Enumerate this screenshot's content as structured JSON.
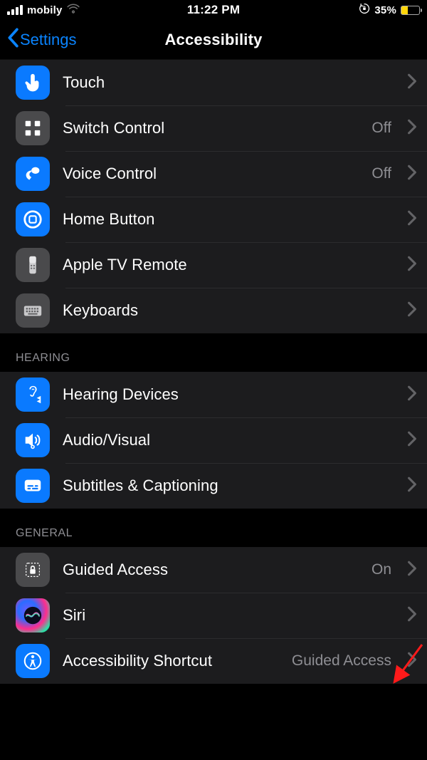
{
  "status": {
    "carrier": "mobily",
    "time": "11:22 PM",
    "battery_pct": "35%",
    "battery_level": 35,
    "battery_color": "#ffd60a"
  },
  "nav": {
    "back_label": "Settings",
    "title": "Accessibility"
  },
  "groups": [
    {
      "header": "",
      "rows": [
        {
          "icon": "touch-icon",
          "bg": "bg-blue",
          "label": "Touch",
          "value": ""
        },
        {
          "icon": "switch-control-icon",
          "bg": "bg-gray",
          "label": "Switch Control",
          "value": "Off"
        },
        {
          "icon": "voice-control-icon",
          "bg": "bg-blue",
          "label": "Voice Control",
          "value": "Off"
        },
        {
          "icon": "home-button-icon",
          "bg": "bg-blue",
          "label": "Home Button",
          "value": ""
        },
        {
          "icon": "apple-tv-remote-icon",
          "bg": "bg-gray",
          "label": "Apple TV Remote",
          "value": ""
        },
        {
          "icon": "keyboards-icon",
          "bg": "bg-gray",
          "label": "Keyboards",
          "value": ""
        }
      ]
    },
    {
      "header": "HEARING",
      "rows": [
        {
          "icon": "hearing-devices-icon",
          "bg": "bg-blue",
          "label": "Hearing Devices",
          "value": ""
        },
        {
          "icon": "audio-visual-icon",
          "bg": "bg-blue",
          "label": "Audio/Visual",
          "value": ""
        },
        {
          "icon": "subtitles-icon",
          "bg": "bg-blue",
          "label": "Subtitles & Captioning",
          "value": ""
        }
      ]
    },
    {
      "header": "GENERAL",
      "rows": [
        {
          "icon": "guided-access-icon",
          "bg": "bg-gray",
          "label": "Guided Access",
          "value": "On"
        },
        {
          "icon": "siri-icon",
          "bg": "bg-siri",
          "label": "Siri",
          "value": ""
        },
        {
          "icon": "accessibility-shortcut-icon",
          "bg": "bg-blue",
          "label": "Accessibility Shortcut",
          "value": "Guided Access"
        }
      ]
    }
  ]
}
